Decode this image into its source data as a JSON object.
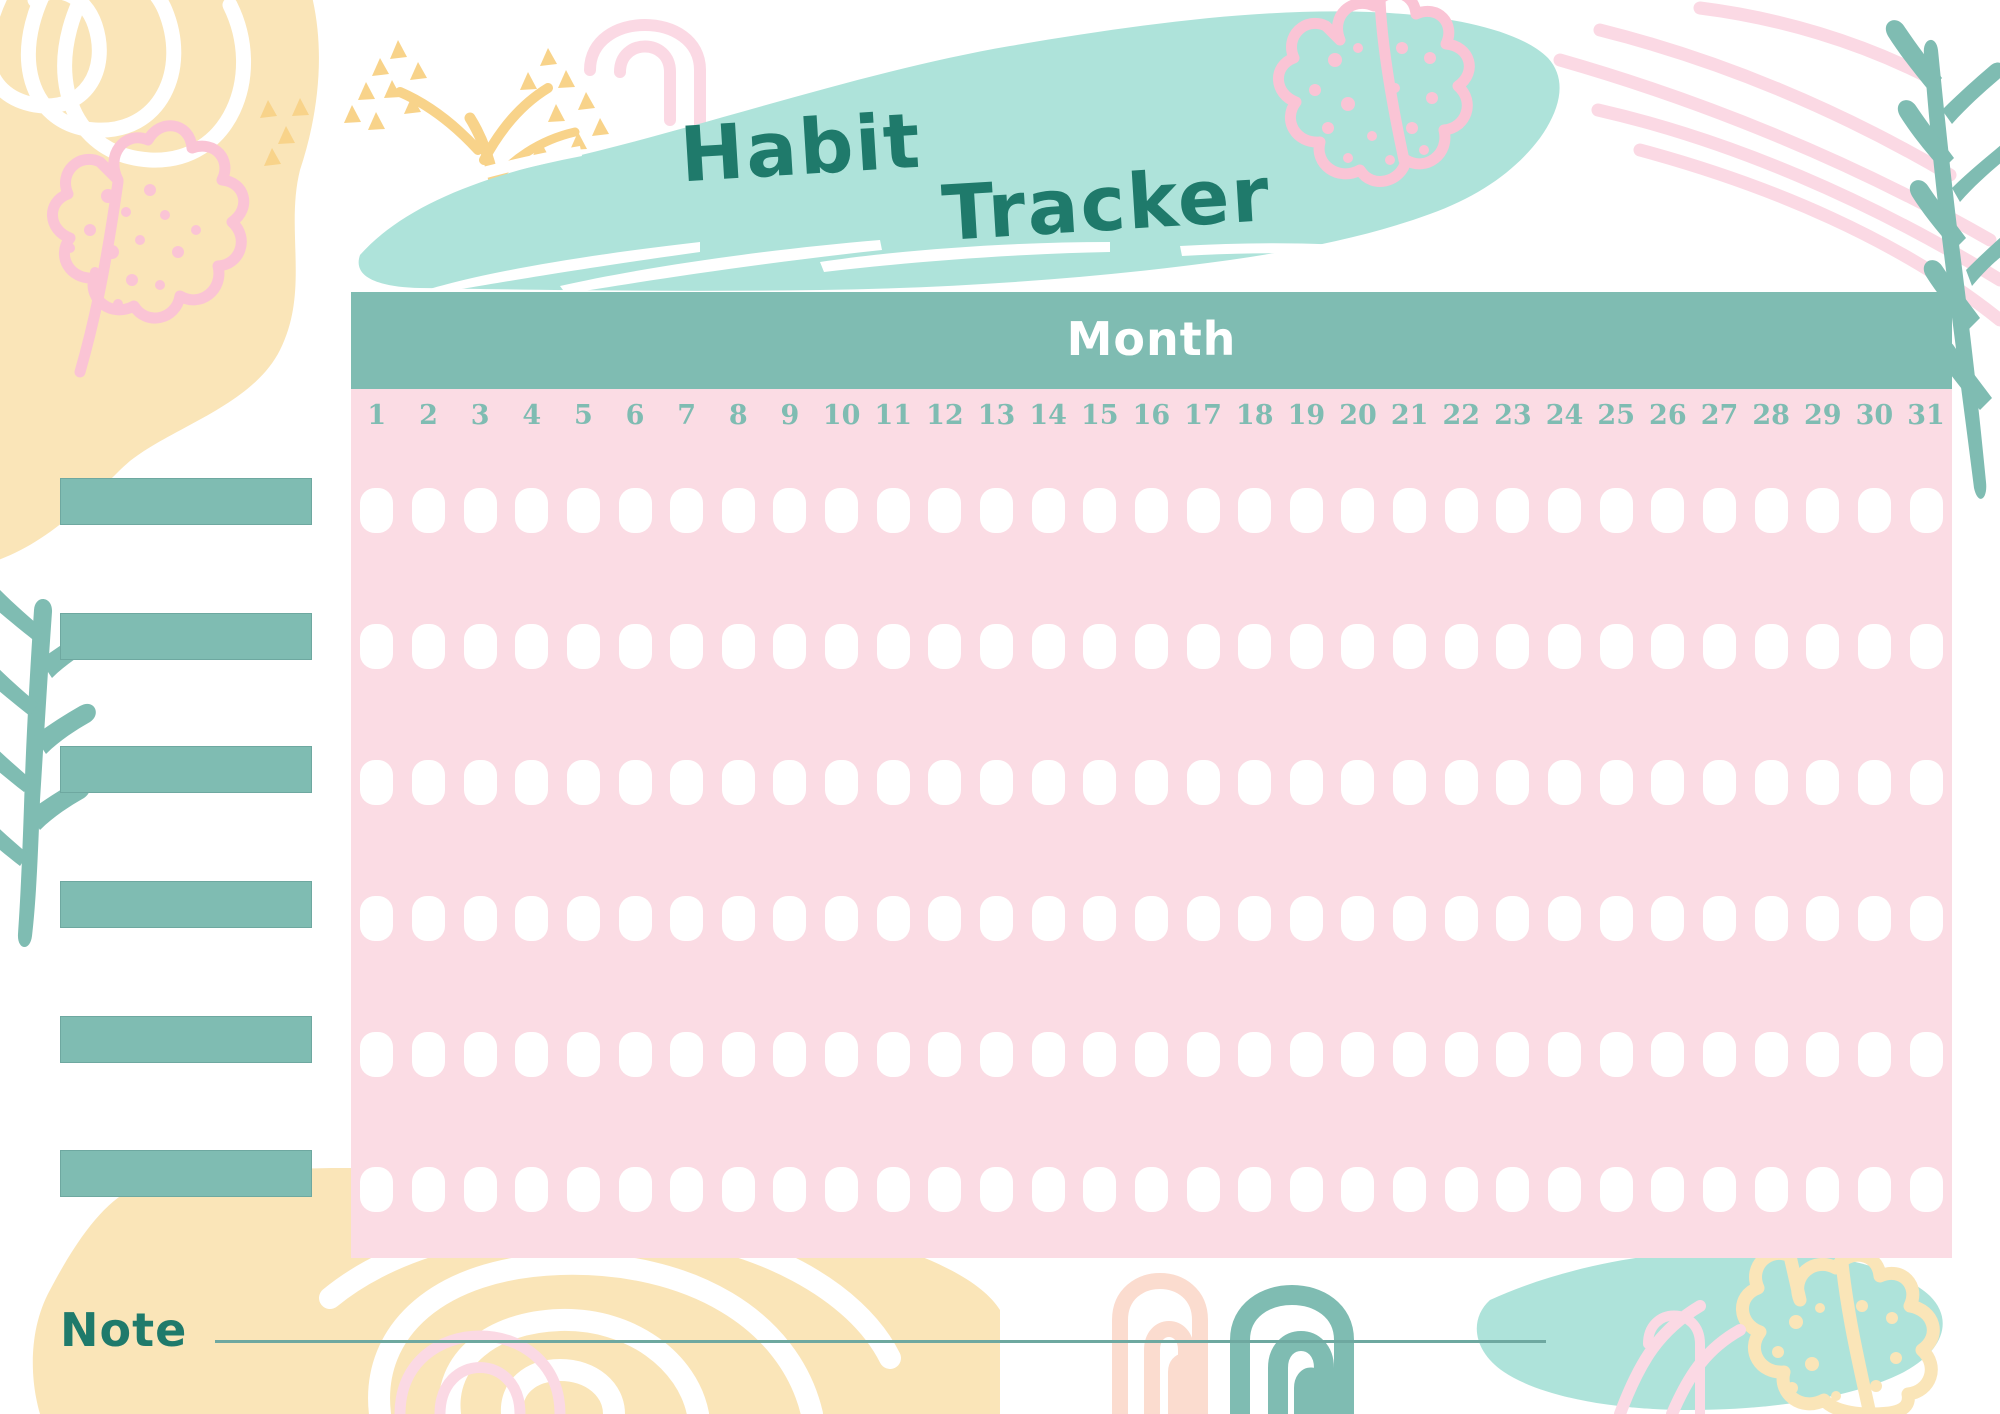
{
  "title": {
    "word1": "Habit",
    "word2": "Tracker"
  },
  "month": {
    "header_label": "Month",
    "value": ""
  },
  "grid": {
    "day_numbers": [
      "1",
      "2",
      "3",
      "4",
      "5",
      "6",
      "7",
      "8",
      "9",
      "10",
      "11",
      "12",
      "13",
      "14",
      "15",
      "16",
      "17",
      "18",
      "19",
      "20",
      "21",
      "22",
      "23",
      "24",
      "25",
      "26",
      "27",
      "28",
      "29",
      "30",
      "31"
    ],
    "row_count": 6,
    "column_count": 31,
    "checkbox_state": "empty"
  },
  "habits": [
    {
      "label": ""
    },
    {
      "label": ""
    },
    {
      "label": ""
    },
    {
      "label": ""
    },
    {
      "label": ""
    },
    {
      "label": ""
    }
  ],
  "note": {
    "label": "Note",
    "value": ""
  },
  "colors": {
    "page_background": "#FFFFFF",
    "title_text": "#1F7A6B",
    "month_bar": "#7FBCB2",
    "month_label_text": "#FFFFFF",
    "grid_panel": "#FBDCE4",
    "day_number_text": "#7FBCB2",
    "checkbox_fill": "#FFFFFF",
    "habit_bar": "#7FBCB2",
    "habit_bar_border": "#6EA8A0",
    "note_line": "#6EA8A0",
    "deco_mint": "#AEE3DA",
    "deco_pink": "#FAC4D5",
    "deco_pink_light": "#FBD9E4",
    "deco_cream": "#FAE5B8",
    "deco_peach": "#FBDCCF",
    "deco_teal": "#7FBCB2"
  },
  "decorations": [
    {
      "name": "cream-splash-top-left",
      "icon": "paint-splash-icon"
    },
    {
      "name": "white-spiral-top-left",
      "icon": "spiral-icon"
    },
    {
      "name": "pink-oak-leaf-left",
      "icon": "leaf-icon"
    },
    {
      "name": "yellow-sprig-top",
      "icon": "sprig-icon"
    },
    {
      "name": "pink-arch-top",
      "icon": "arch-icon"
    },
    {
      "name": "mint-brush-stroke-title",
      "icon": "brush-stroke-icon"
    },
    {
      "name": "pink-oak-leaf-top-right",
      "icon": "leaf-icon"
    },
    {
      "name": "pink-arcs-top-right",
      "icon": "arc-lines-icon"
    },
    {
      "name": "teal-fern-right",
      "icon": "fern-icon"
    },
    {
      "name": "teal-fern-left",
      "icon": "fern-icon"
    },
    {
      "name": "cream-splash-bottom",
      "icon": "paint-splash-icon"
    },
    {
      "name": "cream-spiral-bottom",
      "icon": "spiral-icon"
    },
    {
      "name": "peach-arch-bottom",
      "icon": "arch-icon"
    },
    {
      "name": "teal-arch-bottom",
      "icon": "arch-icon"
    },
    {
      "name": "mint-brush-bottom-right",
      "icon": "brush-stroke-icon"
    },
    {
      "name": "cream-leaf-bottom-right",
      "icon": "leaf-icon"
    },
    {
      "name": "pink-arcs-bottom-right",
      "icon": "arc-lines-icon"
    }
  ]
}
